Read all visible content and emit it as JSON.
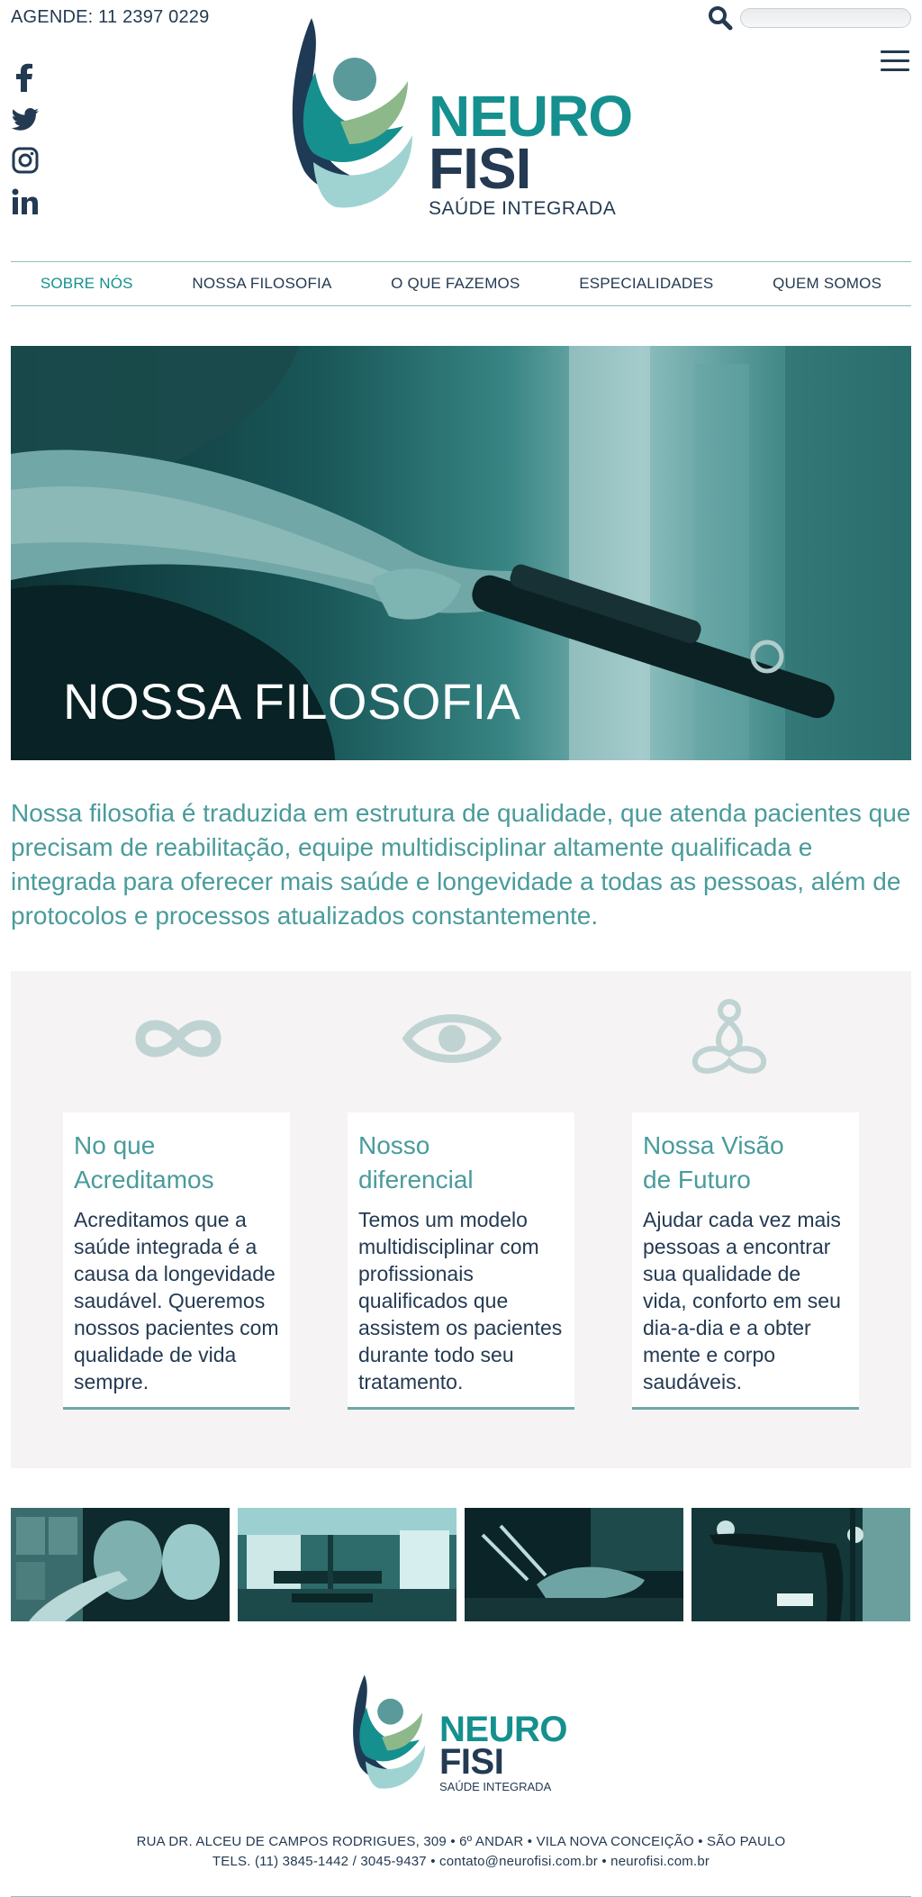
{
  "topbar": {
    "phone_text": "AGENDE: 11 2397 0229",
    "search_placeholder": ""
  },
  "social": [
    "facebook-icon",
    "twitter-icon",
    "instagram-icon",
    "linkedin-icon"
  ],
  "logo": {
    "line1": "NEURO",
    "line2": "FISI",
    "tagline": "SAÚDE INTEGRADA"
  },
  "nav": {
    "items": [
      {
        "label": "SOBRE NÓS",
        "active": true
      },
      {
        "label": "NOSSA FILOSOFIA",
        "active": false
      },
      {
        "label": "O QUE FAZEMOS",
        "active": false
      },
      {
        "label": "ESPECIALIDADES",
        "active": false
      },
      {
        "label": "QUEM SOMOS",
        "active": false
      }
    ]
  },
  "hero": {
    "title": "NOSSA FILOSOFIA"
  },
  "intro": "Nossa filosofia é traduzida em estrutura de qualidade, que atenda pacientes que precisam de reabilitação, equipe multidisciplinar altamente qualificada e integrada para oferecer mais saúde e longevidade a todas as pessoas, além de protocolos e processos atualizados constantemente.",
  "features": [
    {
      "icon": "infinity-icon",
      "title_line1": "No que",
      "title_line2": "Acreditamos",
      "text": "Acreditamos que a saúde integrada é a causa da longevidade saudável. Queremos nossos pacientes com qualidade de vida sempre."
    },
    {
      "icon": "eye-icon",
      "title_line1": "Nosso",
      "title_line2": "diferencial",
      "text": "Temos um modelo multidisciplinar com profissionais qualificados que assistem os pacientes durante todo seu tratamento."
    },
    {
      "icon": "meditation-icon",
      "title_line1": "Nossa Visão",
      "title_line2": "de Futuro",
      "text": "Ajudar cada vez mais pessoas a encontrar sua qualidade de vida, conforto em seu dia-a-dia e a obter mente e corpo saudáveis."
    }
  ],
  "gallery": [
    "xray-photo",
    "gym-photo",
    "pilates-photo",
    "barre-photo"
  ],
  "footer": {
    "logo_line1": "NEURO",
    "logo_line2": "FISI",
    "logo_tagline": "SAÚDE INTEGRADA",
    "address_line1": "RUA DR. ALCEU DE CAMPOS RODRIGUES, 309 • 6º ANDAR • VILA NOVA CONCEIÇÃO • SÃO PAULO",
    "address_line2": "TELS. (11) 3845-1442 / 3045-9437 • contato@neurofisi.com.br • neurofisi.com.br"
  },
  "colors": {
    "teal": "#15908f",
    "navy": "#243a52",
    "light_teal": "#4a9b9b",
    "panel_bg": "#f5f3f3"
  }
}
